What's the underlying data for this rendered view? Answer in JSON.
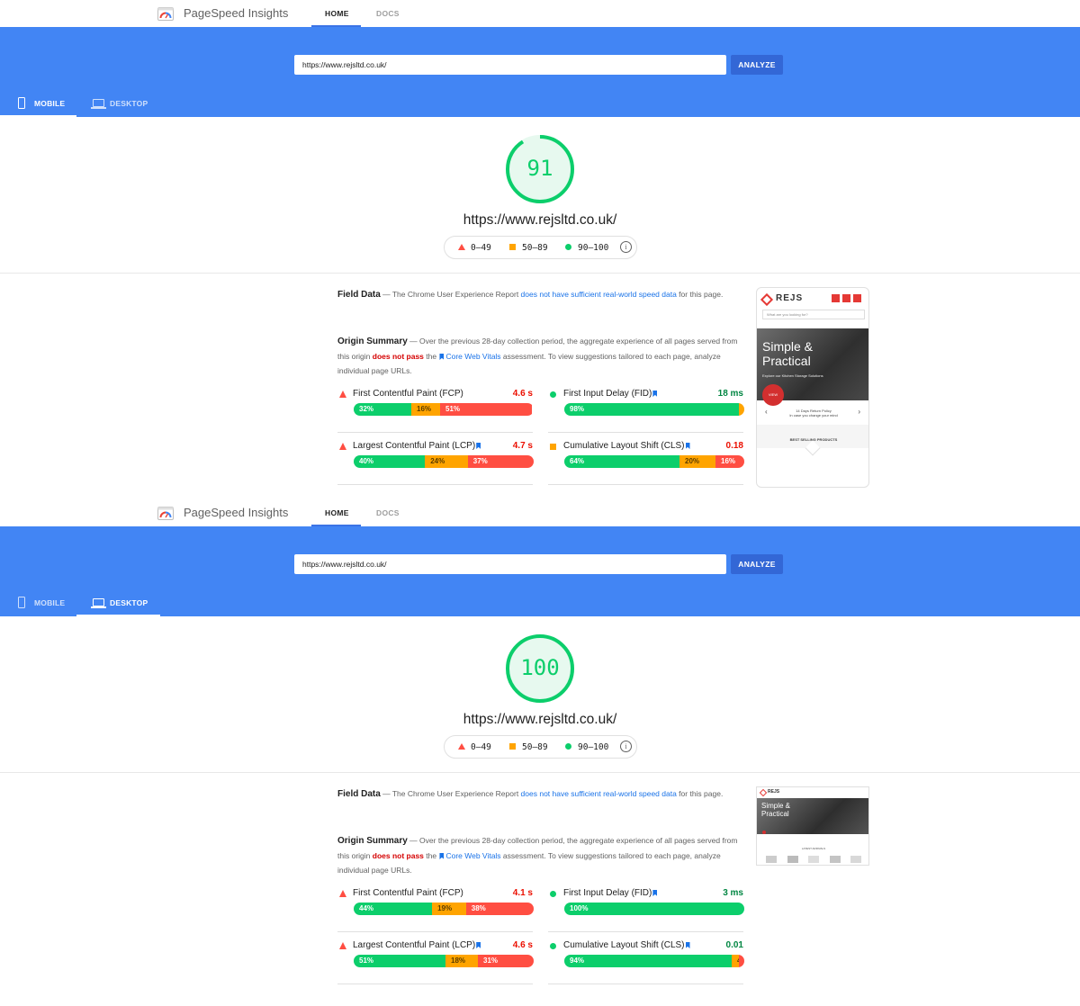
{
  "header": {
    "brand": "PageSpeed Insights",
    "tabs": [
      "HOME",
      "DOCS"
    ]
  },
  "search": {
    "url": "https://www.rejsltd.co.uk/",
    "analyze_label": "ANALYZE"
  },
  "device_tabs": [
    "MOBILE",
    "DESKTOP"
  ],
  "legend": {
    "fail": "0–49",
    "average": "50–89",
    "pass": "90–100",
    "info_icon": "info-icon"
  },
  "page_url": "https://www.rejsltd.co.uk/",
  "field_data": {
    "title": "Field Data",
    "pre": " — The Chrome User Experience Report ",
    "link": "does not have sufficient real-world speed data",
    "post": " for this page."
  },
  "origin_summary": {
    "title": "Origin Summary",
    "t1": " — Over the previous 28-day collection period, the aggregate experience of all pages served from this origin ",
    "fail": "does not pass",
    "t2": " the ",
    "link": "Core Web Vitals",
    "t3": " assessment. To view suggestions tailored to each page, analyze individual page URLs."
  },
  "thumbnail": {
    "brand": "REJS",
    "search_placeholder": "What are you looking for?",
    "hero_line1": "Simple &",
    "hero_line2": "Practical",
    "hero_sub": "Explore our Kitchen Storage Solutions",
    "cta": "VIEW",
    "return_policy_1": "14 Days Return Policy",
    "return_policy_2": "In case you change your mind",
    "best_selling": "BEST SELLING PRODUCTS",
    "desktop_section": "LATEST ARRIVALS"
  },
  "reports": [
    {
      "active_tab": "MOBILE",
      "score": "91",
      "score_value": 91,
      "metrics": [
        {
          "name": "First Contentful Paint (FCP)",
          "value": "4.6 s",
          "status": "fail",
          "badge": false,
          "dist": [
            {
              "p": 32,
              "label": "32%"
            },
            {
              "p": 16,
              "label": "16%"
            },
            {
              "p": 51,
              "label": "51%"
            }
          ]
        },
        {
          "name": "First Input Delay (FID)",
          "value": "18 ms",
          "status": "pass",
          "badge": true,
          "dist": [
            {
              "p": 98,
              "label": "98%"
            },
            {
              "p": 2,
              "label": "2%"
            },
            {
              "p": 0,
              "label": ""
            }
          ]
        },
        {
          "name": "Largest Contentful Paint (LCP)",
          "value": "4.7 s",
          "status": "fail",
          "badge": true,
          "dist": [
            {
              "p": 40,
              "label": "40%"
            },
            {
              "p": 24,
              "label": "24%"
            },
            {
              "p": 37,
              "label": "37%"
            }
          ]
        },
        {
          "name": "Cumulative Layout Shift (CLS)",
          "value": "0.18",
          "status": "average",
          "badge": true,
          "dist": [
            {
              "p": 64,
              "label": "64%"
            },
            {
              "p": 20,
              "label": "20%"
            },
            {
              "p": 16,
              "label": "16%"
            }
          ]
        }
      ]
    },
    {
      "active_tab": "DESKTOP",
      "score": "100",
      "score_value": 100,
      "metrics": [
        {
          "name": "First Contentful Paint (FCP)",
          "value": "4.1 s",
          "status": "fail",
          "badge": false,
          "dist": [
            {
              "p": 44,
              "label": "44%"
            },
            {
              "p": 19,
              "label": "19%"
            },
            {
              "p": 38,
              "label": "38%"
            }
          ]
        },
        {
          "name": "First Input Delay (FID)",
          "value": "3 ms",
          "status": "pass",
          "badge": true,
          "dist": [
            {
              "p": 100,
              "label": "100%"
            },
            {
              "p": 0,
              "label": ""
            },
            {
              "p": 0,
              "label": ""
            }
          ]
        },
        {
          "name": "Largest Contentful Paint (LCP)",
          "value": "4.6 s",
          "status": "fail",
          "badge": true,
          "dist": [
            {
              "p": 51,
              "label": "51%"
            },
            {
              "p": 18,
              "label": "18%"
            },
            {
              "p": 31,
              "label": "31%"
            }
          ]
        },
        {
          "name": "Cumulative Layout Shift (CLS)",
          "value": "0.01",
          "status": "pass",
          "badge": true,
          "dist": [
            {
              "p": 94,
              "label": "94%"
            },
            {
              "p": 4,
              "label": "4%"
            },
            {
              "p": 2,
              "label": "2%"
            }
          ]
        }
      ]
    }
  ],
  "colors": {
    "blue_band": "#4285f4",
    "analyze": "#3367d6",
    "pass": "#0cce6b",
    "average": "#ffa400",
    "fail": "#ff4e42",
    "link": "#1a73e8"
  }
}
